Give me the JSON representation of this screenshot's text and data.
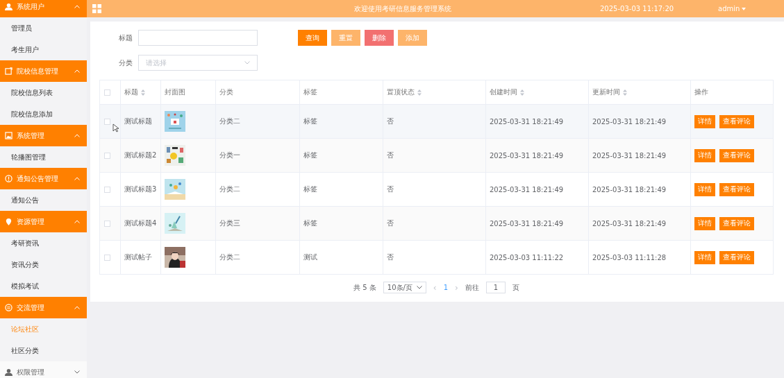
{
  "sidebar": {
    "groups": [
      {
        "label": "系统用户",
        "expanded": true,
        "children": [
          {
            "label": "管理员",
            "selected": false
          },
          {
            "label": "考生用户",
            "selected": false
          }
        ]
      },
      {
        "label": "院校信息管理",
        "expanded": true,
        "children": [
          {
            "label": "院校信息列表",
            "selected": false
          },
          {
            "label": "院校信息添加",
            "selected": false
          }
        ]
      },
      {
        "label": "系统管理",
        "expanded": true,
        "children": [
          {
            "label": "轮播图管理",
            "selected": false
          }
        ]
      },
      {
        "label": "通知公告管理",
        "expanded": true,
        "children": [
          {
            "label": "通知公告",
            "selected": false
          }
        ]
      },
      {
        "label": "资源管理",
        "expanded": true,
        "children": [
          {
            "label": "考研资讯",
            "selected": false
          },
          {
            "label": "资讯分类",
            "selected": false
          },
          {
            "label": "模拟考试",
            "selected": false
          }
        ]
      },
      {
        "label": "交流管理",
        "expanded": true,
        "children": [
          {
            "label": "论坛社区",
            "selected": true
          },
          {
            "label": "社区分类",
            "selected": false
          }
        ]
      },
      {
        "label": "权限管理",
        "expanded": false
      }
    ]
  },
  "header": {
    "title": "欢迎使用考研信息服务管理系统",
    "datetime": "2025-03-03 11:17:20",
    "user": "admin"
  },
  "filters": [
    {
      "label": "标题",
      "kind": "text"
    },
    {
      "label": "分类",
      "kind": "select",
      "placeholder": "请选择"
    }
  ],
  "actions": [
    {
      "label": "查询",
      "kind": "primary"
    },
    {
      "label": "重置",
      "kind": "light"
    },
    {
      "label": "删除",
      "kind": "danger"
    },
    {
      "label": "添加",
      "kind": "light"
    }
  ],
  "table": {
    "all_checked": false,
    "columns": [
      {
        "label": "标题",
        "sortable": true
      },
      {
        "label": "封面图",
        "sortable": false
      },
      {
        "label": "分类",
        "sortable": false
      },
      {
        "label": "标签",
        "sortable": false
      },
      {
        "label": "置顶状态",
        "sortable": true
      },
      {
        "label": "创建时间",
        "sortable": true
      },
      {
        "label": "更新时间",
        "sortable": true
      },
      {
        "label": "操作",
        "sortable": false
      }
    ],
    "rows": [
      {
        "hovered": true,
        "checked": false,
        "title": "测试标题",
        "cover": {
          "kind": "picture"
        },
        "category": "分类二",
        "tag": "标签",
        "pinned": "否",
        "created": "2025-03-31 18:21:49",
        "updated": "2025-03-31 18:21:49",
        "buttons": [
          "详情",
          "查看评论"
        ]
      },
      {
        "hovered": false,
        "checked": false,
        "title": "测试标题2",
        "cover": {
          "kind": "picture"
        },
        "category": "分类一",
        "tag": "标签",
        "pinned": "否",
        "created": "2025-03-31 18:21:49",
        "updated": "2025-03-31 18:21:49",
        "buttons": [
          "详情",
          "查看评论"
        ]
      },
      {
        "hovered": false,
        "checked": false,
        "title": "测试标题3",
        "cover": {
          "kind": "picture"
        },
        "category": "分类二",
        "tag": "标签",
        "pinned": "否",
        "created": "2025-03-31 18:21:49",
        "updated": "2025-03-31 18:21:49",
        "buttons": [
          "详情",
          "查看评论"
        ]
      },
      {
        "hovered": false,
        "checked": false,
        "title": "测试标题4",
        "cover": {
          "kind": "picture"
        },
        "category": "分类三",
        "tag": "标签",
        "pinned": "否",
        "created": "2025-03-31 18:21:49",
        "updated": "2025-03-31 18:21:49",
        "buttons": [
          "详情",
          "查看评论"
        ]
      },
      {
        "hovered": false,
        "checked": false,
        "title": "测试帖子",
        "cover": {
          "kind": "picture"
        },
        "category": "分类二",
        "tag": "测试",
        "pinned": "否",
        "created": "2025-03-03 11:11:22",
        "updated": "2025-03-03 11:11:28",
        "buttons": [
          "详情",
          "查看评论"
        ]
      }
    ]
  },
  "pagination": {
    "total": "共 5 条",
    "page_size": "10条/页",
    "prev": "‹",
    "pages": [
      {
        "label": "1",
        "selected": true
      }
    ],
    "next": "›",
    "goto_label": "前往",
    "goto_value": "1",
    "goto_suffix": "页"
  }
}
